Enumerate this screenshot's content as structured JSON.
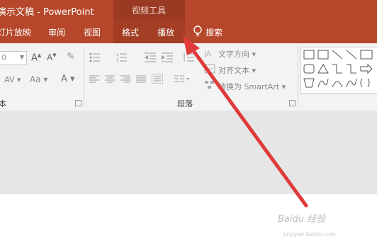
{
  "window": {
    "title": "演示文稿  -  PowerPoint",
    "context_group": "视频工具"
  },
  "tabs": [
    {
      "label": "灯片放映"
    },
    {
      "label": "审阅"
    },
    {
      "label": "视图"
    },
    {
      "label": "格式"
    },
    {
      "label": "播放"
    },
    {
      "label": "搜索"
    }
  ],
  "ribbon": {
    "font_size_value": "0",
    "text_direction": "文字方向",
    "align_text": "对齐文本",
    "convert_smartart": "转换为 SmartArt",
    "font_group_label": "本",
    "paragraph_group_label": "段落",
    "font_case": "Aa",
    "font_color": "A"
  },
  "watermark": {
    "brand": "Baidu 经验",
    "url": "jingyan.baidu.com"
  },
  "annotation": {
    "arrow_color": "#e03a3a"
  }
}
